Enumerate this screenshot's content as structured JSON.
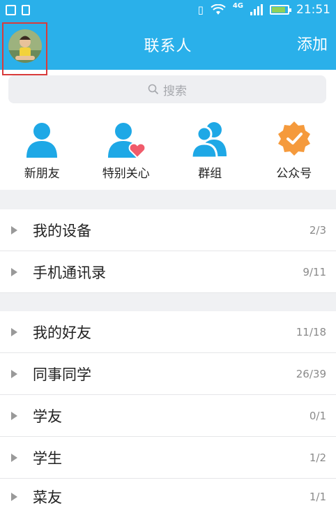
{
  "status_bar": {
    "network": "4G",
    "time": "21:51",
    "battery_level": 0.85
  },
  "header": {
    "title": "联系人",
    "add_label": "添加"
  },
  "search": {
    "placeholder": "搜索"
  },
  "quick_actions": [
    {
      "label": "新朋友",
      "icon": "person-icon",
      "color": "#1ea8e6"
    },
    {
      "label": "特别关心",
      "icon": "person-heart-icon",
      "color": "#1ea8e6"
    },
    {
      "label": "群组",
      "icon": "group-icon",
      "color": "#1ea8e6"
    },
    {
      "label": "公众号",
      "icon": "verified-badge-icon",
      "color": "#f59a3c"
    }
  ],
  "groups": [
    {
      "name": "我的设备",
      "count": "2/3"
    },
    {
      "name": "手机通讯录",
      "count": "9/11"
    },
    {
      "name": "我的好友",
      "count": "11/18"
    },
    {
      "name": "同事同学",
      "count": "26/39"
    },
    {
      "name": "学友",
      "count": "0/1"
    },
    {
      "name": "学生",
      "count": "1/2"
    },
    {
      "name": "菜友",
      "count": "1/1"
    }
  ],
  "colors": {
    "brand": "#2ab0ea",
    "avatar_highlight": "#d93b3b",
    "section_gap": "#f0f1f3"
  }
}
